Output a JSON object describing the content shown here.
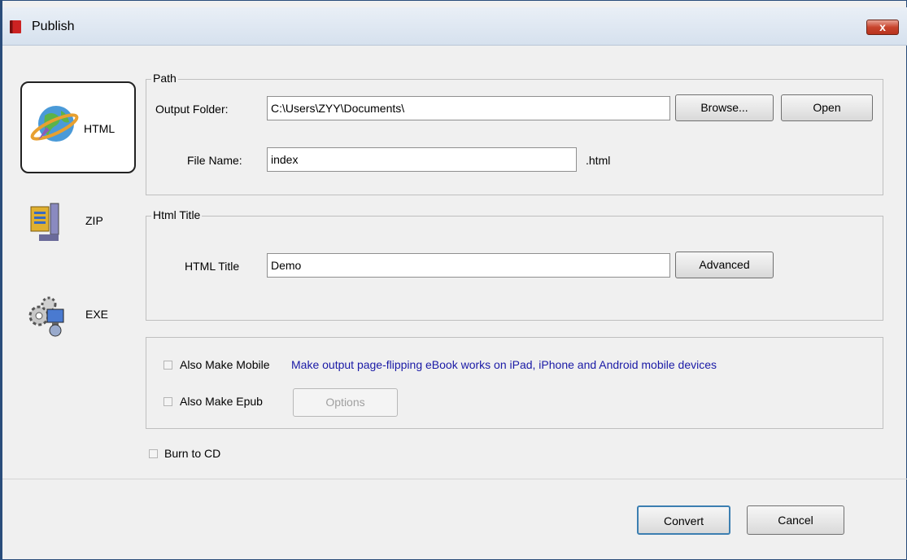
{
  "window": {
    "title": "Publish",
    "close_label": "x"
  },
  "sidebar": {
    "items": [
      {
        "label": "HTML",
        "icon": "globe-icon",
        "selected": true
      },
      {
        "label": "ZIP",
        "icon": "zip-archive-icon",
        "selected": false
      },
      {
        "label": "EXE",
        "icon": "gears-computer-icon",
        "selected": false
      }
    ]
  },
  "path_group": {
    "legend": "Path",
    "output_folder_label": "Output Folder:",
    "output_folder_value": "C:\\Users\\ZYY\\Documents\\",
    "browse_label": "Browse...",
    "open_label": "Open",
    "file_name_label": "File Name:",
    "file_name_value": "index",
    "extension": ".html"
  },
  "title_group": {
    "legend": "Html Title",
    "html_title_label": "HTML Title",
    "html_title_value": "Demo",
    "advanced_label": "Advanced"
  },
  "options_group": {
    "mobile_label": "Also Make Mobile",
    "mobile_desc": "Make output page-flipping eBook works on iPad, iPhone and Android mobile devices",
    "epub_label": "Also Make Epub",
    "options_label": "Options"
  },
  "burn_cd_label": "Burn to CD",
  "footer": {
    "convert_label": "Convert",
    "cancel_label": "Cancel"
  },
  "colors": {
    "link_blue": "#1a1aa6",
    "title_bar": "#dde6f1"
  }
}
